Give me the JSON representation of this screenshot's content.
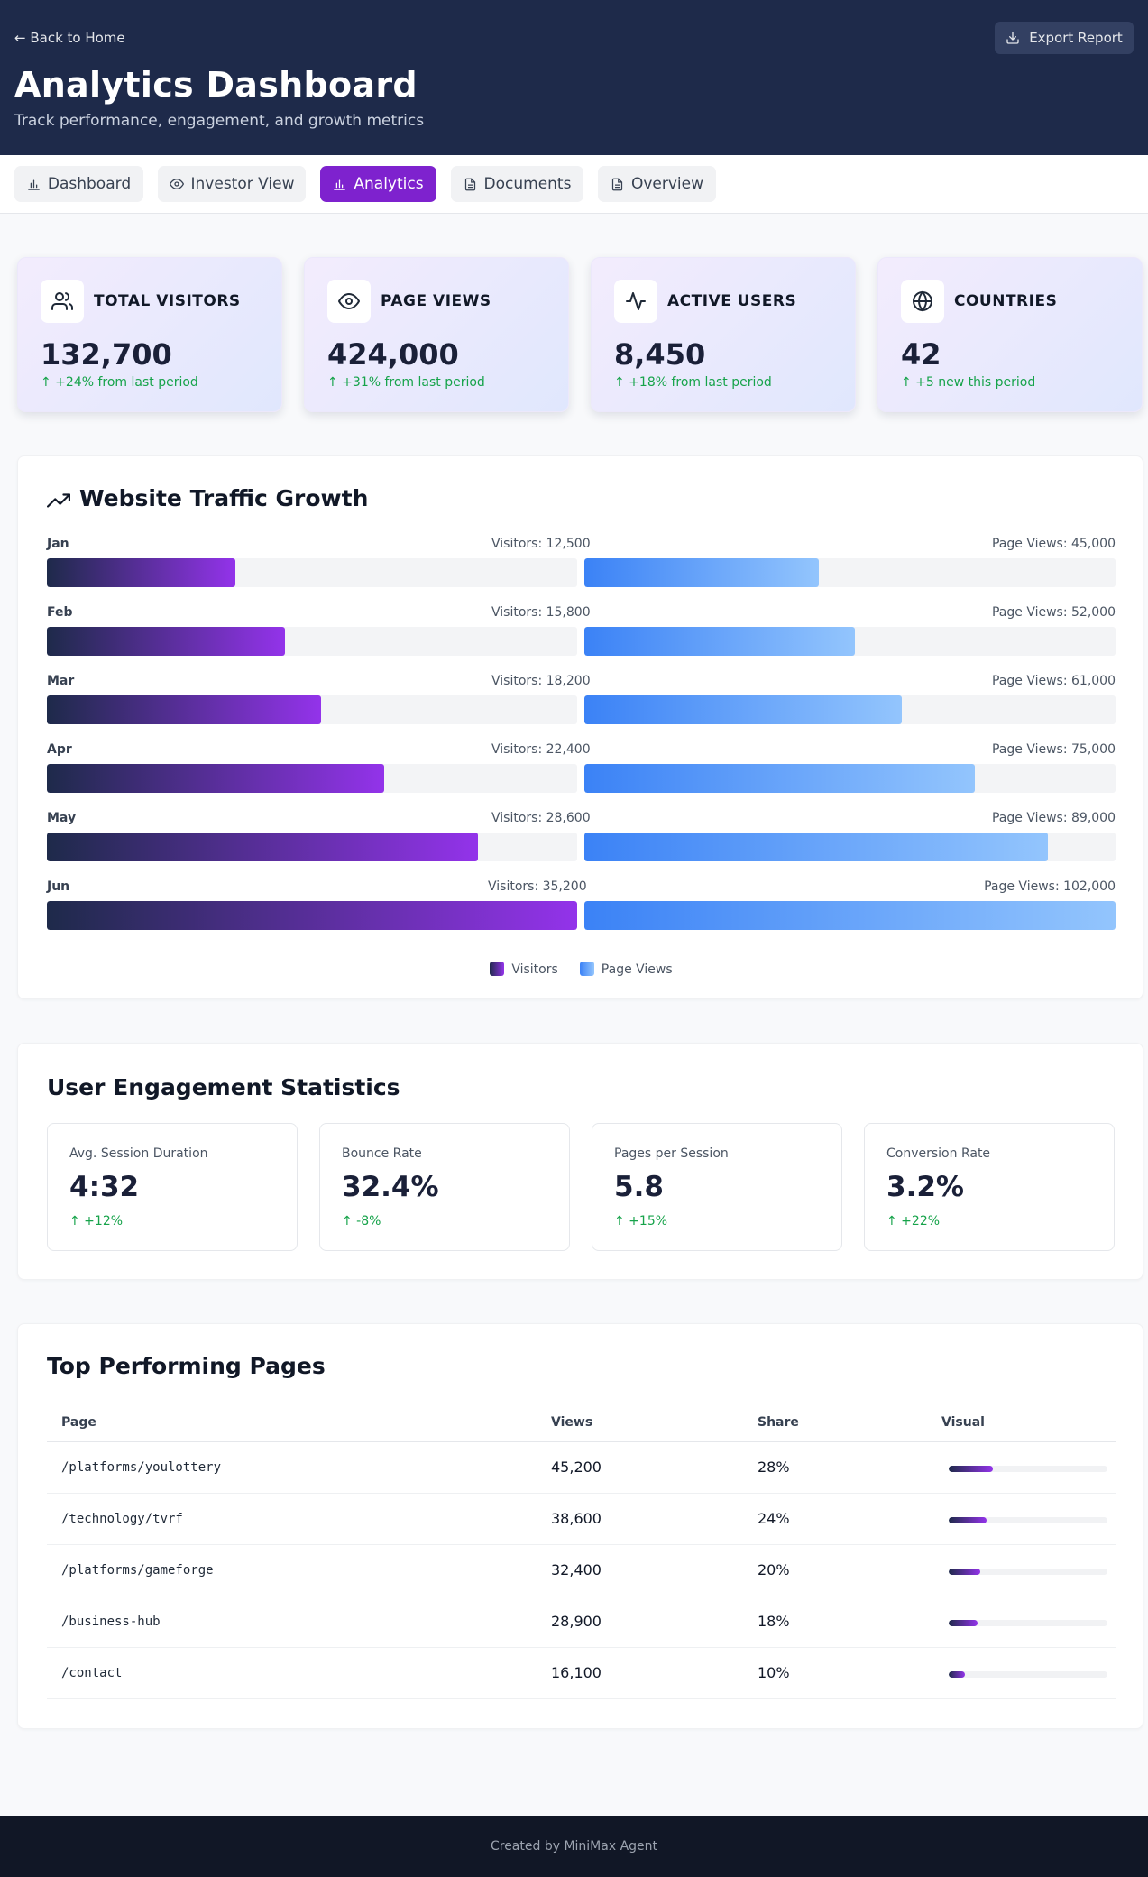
{
  "header": {
    "back_label": "← Back to Home",
    "export_label": "Export Report",
    "title": "Analytics Dashboard",
    "subtitle": "Track performance, engagement, and growth metrics"
  },
  "nav": {
    "tabs": [
      {
        "label": "Dashboard",
        "icon": "bar-chart-icon"
      },
      {
        "label": "Investor View",
        "icon": "eye-icon"
      },
      {
        "label": "Analytics",
        "icon": "bar-chart-icon",
        "active": true
      },
      {
        "label": "Documents",
        "icon": "document-icon"
      },
      {
        "label": "Overview",
        "icon": "document-icon"
      }
    ]
  },
  "stats": [
    {
      "label": "TOTAL VISITORS",
      "value": "132,700",
      "change": "↑ +24% from last period",
      "icon": "users-icon"
    },
    {
      "label": "PAGE VIEWS",
      "value": "424,000",
      "change": "↑ +31% from last period",
      "icon": "eye-icon"
    },
    {
      "label": "ACTIVE USERS",
      "value": "8,450",
      "change": "↑ +18% from last period",
      "icon": "activity-icon"
    },
    {
      "label": "COUNTRIES",
      "value": "42",
      "change": "↑ +5 new this period",
      "icon": "globe-icon"
    }
  ],
  "traffic": {
    "title": "Website Traffic Growth",
    "rows": [
      {
        "month": "Jan",
        "visitors_label": "Visitors: 12,500",
        "views_label": "Page Views: 45,000",
        "visitors": 12500,
        "views": 45000
      },
      {
        "month": "Feb",
        "visitors_label": "Visitors: 15,800",
        "views_label": "Page Views: 52,000",
        "visitors": 15800,
        "views": 52000
      },
      {
        "month": "Mar",
        "visitors_label": "Visitors: 18,200",
        "views_label": "Page Views: 61,000",
        "visitors": 18200,
        "views": 61000
      },
      {
        "month": "Apr",
        "visitors_label": "Visitors: 22,400",
        "views_label": "Page Views: 75,000",
        "visitors": 22400,
        "views": 75000
      },
      {
        "month": "May",
        "visitors_label": "Visitors: 28,600",
        "views_label": "Page Views: 89,000",
        "visitors": 28600,
        "views": 89000
      },
      {
        "month": "Jun",
        "visitors_label": "Visitors: 35,200",
        "views_label": "Page Views: 102,000",
        "visitors": 35200,
        "views": 102000
      }
    ],
    "legend": {
      "visitors": "Visitors",
      "views": "Page Views"
    }
  },
  "engagement": {
    "title": "User Engagement Statistics",
    "items": [
      {
        "label": "Avg. Session Duration",
        "value": "4:32",
        "change": "↑ +12%"
      },
      {
        "label": "Bounce Rate",
        "value": "32.4%",
        "change": "↑ -8%"
      },
      {
        "label": "Pages per Session",
        "value": "5.8",
        "change": "↑ +15%"
      },
      {
        "label": "Conversion Rate",
        "value": "3.2%",
        "change": "↑ +22%"
      }
    ]
  },
  "top_pages": {
    "title": "Top Performing Pages",
    "columns": [
      "Page",
      "Views",
      "Share",
      "Visual"
    ],
    "rows": [
      {
        "page": "/platforms/youlottery",
        "views": "45,200",
        "share": "28%",
        "share_value": 28
      },
      {
        "page": "/technology/tvrf",
        "views": "38,600",
        "share": "24%",
        "share_value": 24
      },
      {
        "page": "/platforms/gameforge",
        "views": "32,400",
        "share": "20%",
        "share_value": 20
      },
      {
        "page": "/business-hub",
        "views": "28,900",
        "share": "18%",
        "share_value": 18
      },
      {
        "page": "/contact",
        "views": "16,100",
        "share": "10%",
        "share_value": 10
      }
    ]
  },
  "footer": {
    "text": "Created by MiniMax Agent"
  }
}
